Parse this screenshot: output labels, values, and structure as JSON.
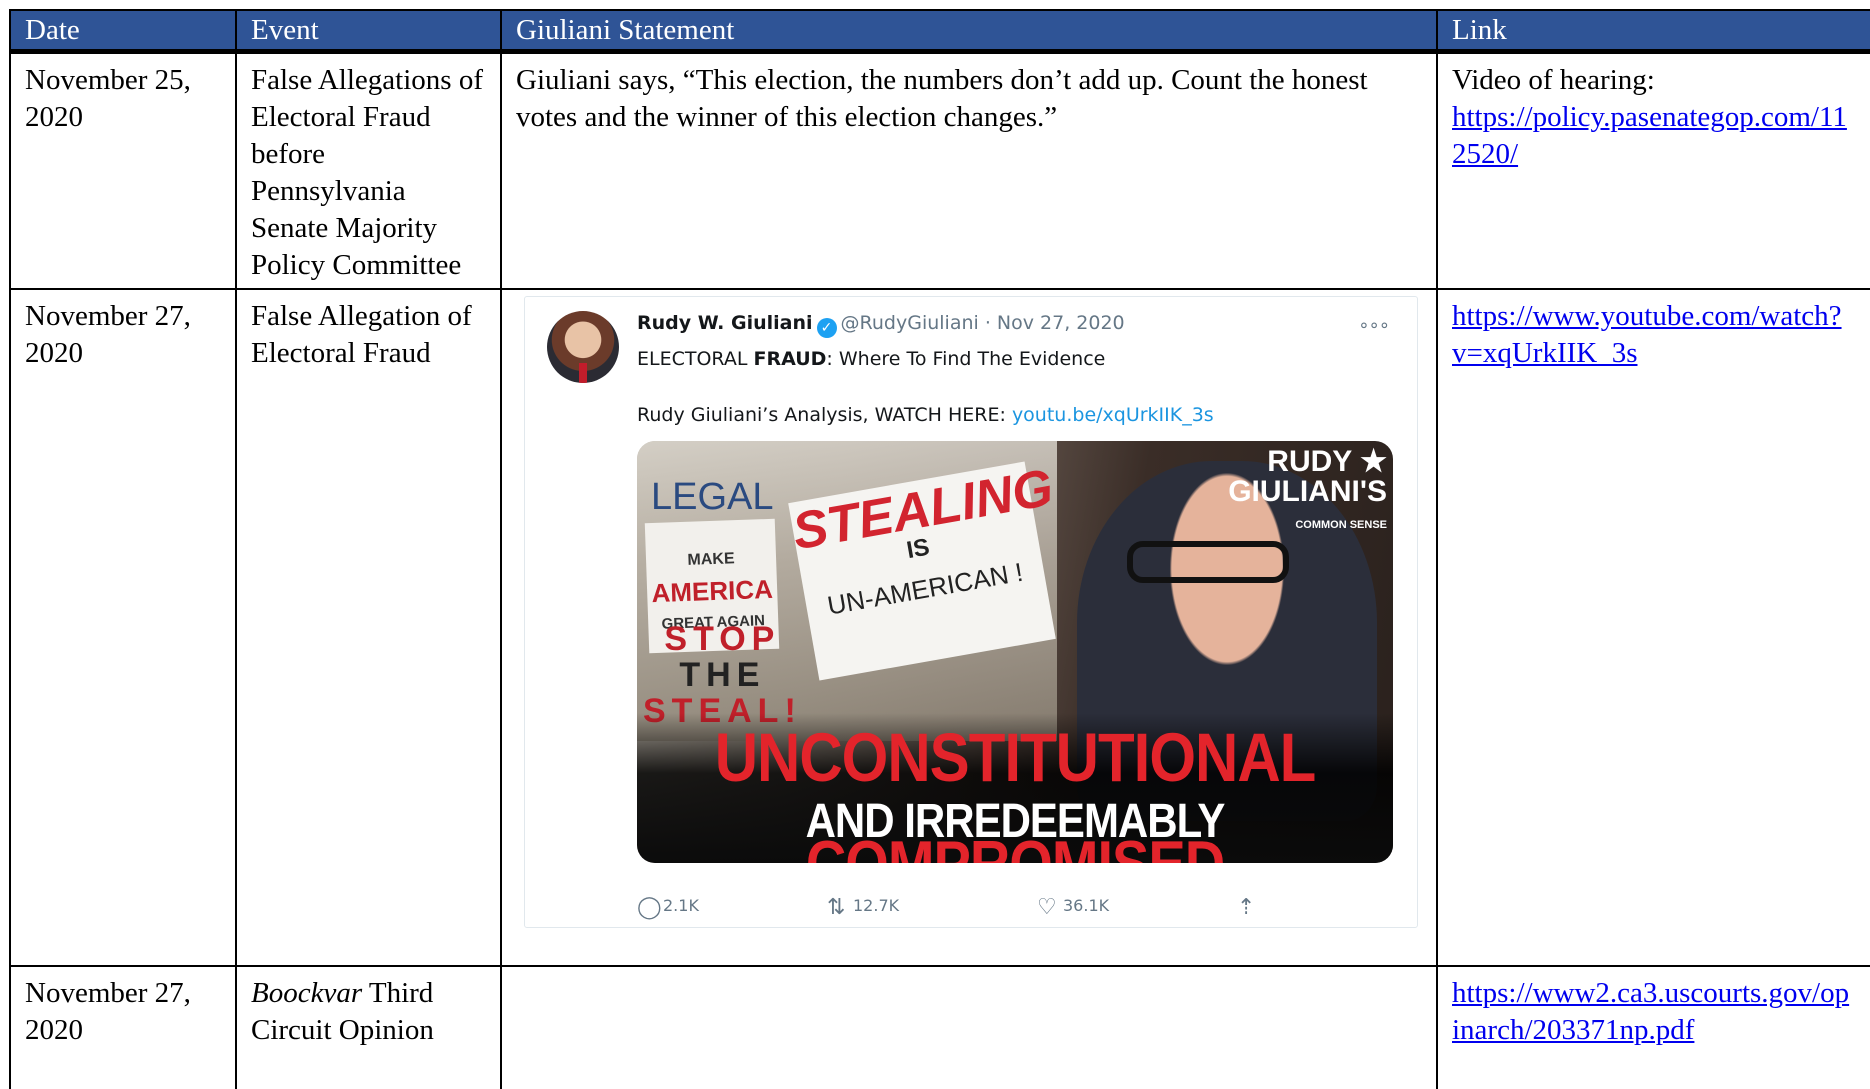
{
  "table": {
    "headers": [
      "Date",
      "Event",
      "Giuliani Statement",
      "Link"
    ],
    "rows": [
      {
        "date": "November 25, 2020",
        "event": "False Allegations of Electoral Fraud before Pennsylvania Senate Majority Policy Committee",
        "statement": "Giuliani says, “This election, the numbers don’t add up.  Count the honest votes and the winner of this election changes.”",
        "link_prefix": "Video of hearing:",
        "link": "https://policy.pasenategop.com/112520/"
      },
      {
        "date": "November 27, 2020",
        "event": "False Allegation of Electoral Fraud",
        "link": "https://www.youtube.com/watch?v=xqUrkIIK_3s"
      },
      {
        "date": "November 27, 2020",
        "event_italic": "Boockvar",
        "event_rest": " Third Circuit Opinion",
        "statement": "",
        "link": "https://www2.ca3.uscourts.gov/opinarch/203371np.pdf"
      }
    ]
  },
  "tweet": {
    "name": "Rudy W. Giuliani",
    "verified_mark": "✓",
    "handle": "@RudyGiuliani · Nov 27, 2020",
    "more": "∘∘∘",
    "subtitle_pre": "ELECTORAL ",
    "subtitle_bold": "FRAUD",
    "subtitle_post": ": Where To Find The Evidence",
    "analysis_text": "Rudy Giuliani’s Analysis, WATCH HERE: ",
    "analysis_link": "youtu.be/xqUrkIIK_3s",
    "image": {
      "legal": "LEGAL",
      "maga_1": "MAKE",
      "maga_2": "AMERICA",
      "maga_3": "GREAT AGAIN",
      "stop_1": "STOP",
      "stop_2": "THE",
      "stop_3": "STEAL!",
      "sign_1": "STEALING",
      "sign_2": "IS",
      "sign_3": "UN-AMERICAN !",
      "brand_1": "RUDY ★",
      "brand_2": "GIULIANI'S",
      "brand_3": "COMMON SENSE",
      "headline_1": "UNCONSTITUTIONAL",
      "headline_2": "AND IRREDEEMABLY ",
      "headline_3": "COMPROMISED"
    },
    "actions": {
      "reply_icon": "comment-icon",
      "reply": "2.1K",
      "retweet_icon": "retweet-icon",
      "retweet": "12.7K",
      "like_icon": "heart-icon",
      "like": "36.1K",
      "share_icon": "share-icon"
    }
  },
  "colors": {
    "header_bg": "#2f5496",
    "link": "#0000ee",
    "tweet_link": "#1b95e0",
    "verified": "#1da1f2",
    "headline_red": "#e3242b"
  }
}
